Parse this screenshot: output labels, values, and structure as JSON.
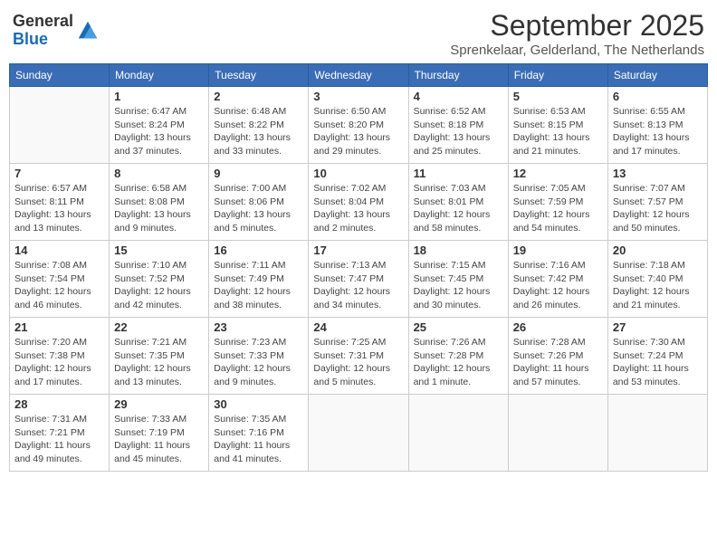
{
  "logo": {
    "general": "General",
    "blue": "Blue"
  },
  "header": {
    "month": "September 2025",
    "subtitle": "Sprenkelaar, Gelderland, The Netherlands"
  },
  "weekdays": [
    "Sunday",
    "Monday",
    "Tuesday",
    "Wednesday",
    "Thursday",
    "Friday",
    "Saturday"
  ],
  "weeks": [
    [
      {
        "day": "",
        "info": ""
      },
      {
        "day": "1",
        "info": "Sunrise: 6:47 AM\nSunset: 8:24 PM\nDaylight: 13 hours\nand 37 minutes."
      },
      {
        "day": "2",
        "info": "Sunrise: 6:48 AM\nSunset: 8:22 PM\nDaylight: 13 hours\nand 33 minutes."
      },
      {
        "day": "3",
        "info": "Sunrise: 6:50 AM\nSunset: 8:20 PM\nDaylight: 13 hours\nand 29 minutes."
      },
      {
        "day": "4",
        "info": "Sunrise: 6:52 AM\nSunset: 8:18 PM\nDaylight: 13 hours\nand 25 minutes."
      },
      {
        "day": "5",
        "info": "Sunrise: 6:53 AM\nSunset: 8:15 PM\nDaylight: 13 hours\nand 21 minutes."
      },
      {
        "day": "6",
        "info": "Sunrise: 6:55 AM\nSunset: 8:13 PM\nDaylight: 13 hours\nand 17 minutes."
      }
    ],
    [
      {
        "day": "7",
        "info": "Sunrise: 6:57 AM\nSunset: 8:11 PM\nDaylight: 13 hours\nand 13 minutes."
      },
      {
        "day": "8",
        "info": "Sunrise: 6:58 AM\nSunset: 8:08 PM\nDaylight: 13 hours\nand 9 minutes."
      },
      {
        "day": "9",
        "info": "Sunrise: 7:00 AM\nSunset: 8:06 PM\nDaylight: 13 hours\nand 5 minutes."
      },
      {
        "day": "10",
        "info": "Sunrise: 7:02 AM\nSunset: 8:04 PM\nDaylight: 13 hours\nand 2 minutes."
      },
      {
        "day": "11",
        "info": "Sunrise: 7:03 AM\nSunset: 8:01 PM\nDaylight: 12 hours\nand 58 minutes."
      },
      {
        "day": "12",
        "info": "Sunrise: 7:05 AM\nSunset: 7:59 PM\nDaylight: 12 hours\nand 54 minutes."
      },
      {
        "day": "13",
        "info": "Sunrise: 7:07 AM\nSunset: 7:57 PM\nDaylight: 12 hours\nand 50 minutes."
      }
    ],
    [
      {
        "day": "14",
        "info": "Sunrise: 7:08 AM\nSunset: 7:54 PM\nDaylight: 12 hours\nand 46 minutes."
      },
      {
        "day": "15",
        "info": "Sunrise: 7:10 AM\nSunset: 7:52 PM\nDaylight: 12 hours\nand 42 minutes."
      },
      {
        "day": "16",
        "info": "Sunrise: 7:11 AM\nSunset: 7:49 PM\nDaylight: 12 hours\nand 38 minutes."
      },
      {
        "day": "17",
        "info": "Sunrise: 7:13 AM\nSunset: 7:47 PM\nDaylight: 12 hours\nand 34 minutes."
      },
      {
        "day": "18",
        "info": "Sunrise: 7:15 AM\nSunset: 7:45 PM\nDaylight: 12 hours\nand 30 minutes."
      },
      {
        "day": "19",
        "info": "Sunrise: 7:16 AM\nSunset: 7:42 PM\nDaylight: 12 hours\nand 26 minutes."
      },
      {
        "day": "20",
        "info": "Sunrise: 7:18 AM\nSunset: 7:40 PM\nDaylight: 12 hours\nand 21 minutes."
      }
    ],
    [
      {
        "day": "21",
        "info": "Sunrise: 7:20 AM\nSunset: 7:38 PM\nDaylight: 12 hours\nand 17 minutes."
      },
      {
        "day": "22",
        "info": "Sunrise: 7:21 AM\nSunset: 7:35 PM\nDaylight: 12 hours\nand 13 minutes."
      },
      {
        "day": "23",
        "info": "Sunrise: 7:23 AM\nSunset: 7:33 PM\nDaylight: 12 hours\nand 9 minutes."
      },
      {
        "day": "24",
        "info": "Sunrise: 7:25 AM\nSunset: 7:31 PM\nDaylight: 12 hours\nand 5 minutes."
      },
      {
        "day": "25",
        "info": "Sunrise: 7:26 AM\nSunset: 7:28 PM\nDaylight: 12 hours\nand 1 minute."
      },
      {
        "day": "26",
        "info": "Sunrise: 7:28 AM\nSunset: 7:26 PM\nDaylight: 11 hours\nand 57 minutes."
      },
      {
        "day": "27",
        "info": "Sunrise: 7:30 AM\nSunset: 7:24 PM\nDaylight: 11 hours\nand 53 minutes."
      }
    ],
    [
      {
        "day": "28",
        "info": "Sunrise: 7:31 AM\nSunset: 7:21 PM\nDaylight: 11 hours\nand 49 minutes."
      },
      {
        "day": "29",
        "info": "Sunrise: 7:33 AM\nSunset: 7:19 PM\nDaylight: 11 hours\nand 45 minutes."
      },
      {
        "day": "30",
        "info": "Sunrise: 7:35 AM\nSunset: 7:16 PM\nDaylight: 11 hours\nand 41 minutes."
      },
      {
        "day": "",
        "info": ""
      },
      {
        "day": "",
        "info": ""
      },
      {
        "day": "",
        "info": ""
      },
      {
        "day": "",
        "info": ""
      }
    ]
  ]
}
